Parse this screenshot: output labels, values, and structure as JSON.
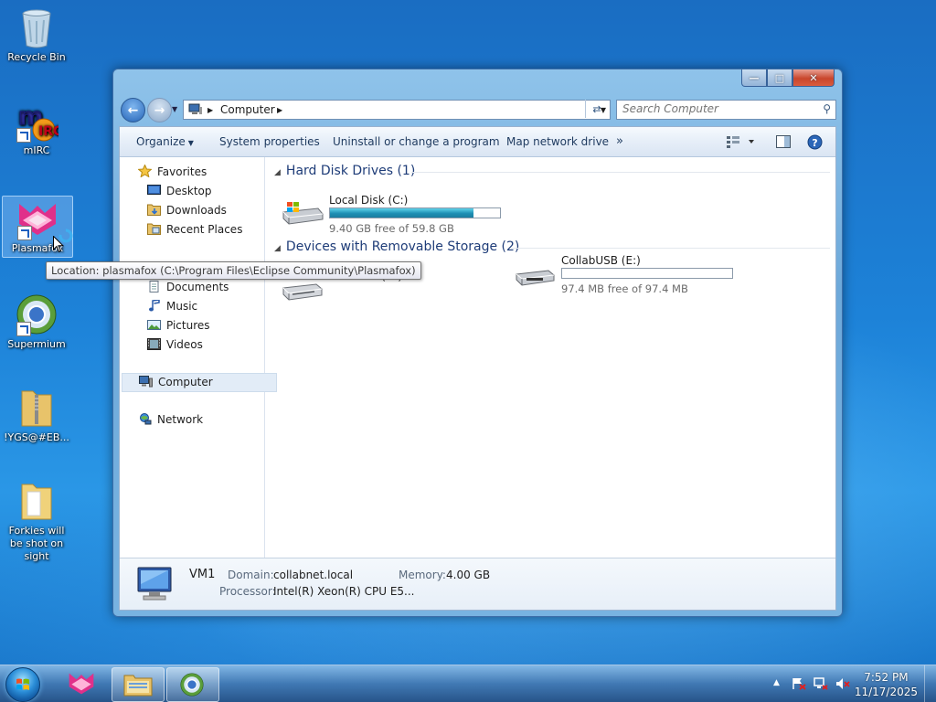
{
  "desktop": {
    "icons": [
      {
        "label": "Recycle Bin"
      },
      {
        "label": "mIRC"
      },
      {
        "label": "Plasmafox"
      },
      {
        "label": "Supermium"
      },
      {
        "label": "!YGS@#EB..."
      },
      {
        "label": "Forkies will be shot on sight"
      }
    ],
    "tooltip": "Location: plasmafox (C:\\Program Files\\Eclipse Community\\Plasmafox)"
  },
  "window": {
    "address": {
      "crumb": "Computer"
    },
    "search": {
      "placeholder": "Search Computer"
    },
    "toolbar": {
      "organize": "Organize",
      "system_properties": "System properties",
      "uninstall": "Uninstall or change a program",
      "map_drive": "Map network drive",
      "more": "»"
    },
    "nav": {
      "favorites": "Favorites",
      "desktop": "Desktop",
      "downloads": "Downloads",
      "recent": "Recent Places",
      "documents": "Documents",
      "music": "Music",
      "pictures": "Pictures",
      "videos": "Videos",
      "computer": "Computer",
      "network": "Network"
    },
    "groups": {
      "hdd": "Hard Disk Drives (1)",
      "removable": "Devices with Removable Storage (2)"
    },
    "drives": [
      {
        "name": "Local Disk (C:)",
        "free": "9.40 GB free of 59.8 GB",
        "used_fraction": 0.843
      },
      {
        "name": "CD Drive (D:)"
      },
      {
        "name": "CollabUSB (E:)",
        "free": "97.4 MB free of 97.4 MB",
        "used_fraction": 0.0
      }
    ],
    "details": {
      "name": "VM1",
      "domain_label": "Domain:",
      "domain": "collabnet.local",
      "memory_label": "Memory:",
      "memory": "4.00 GB",
      "processor_label": "Processor:",
      "processor": "Intel(R) Xeon(R) CPU E5..."
    }
  },
  "taskbar": {
    "time": "7:52 PM",
    "date": "11/17/2025"
  },
  "colors": {
    "accent": "#1e3c78",
    "progress": "#1d8fb3"
  }
}
